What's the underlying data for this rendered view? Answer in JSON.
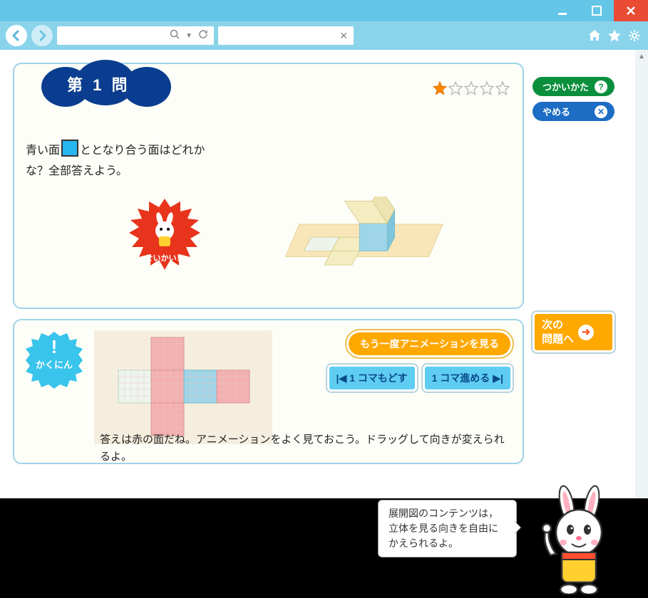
{
  "window": {
    "minimize": "minimize",
    "maximize": "maximize",
    "close": "close"
  },
  "toolbar": {
    "back": "back",
    "forward": "forward",
    "url_value": "",
    "search_value": "",
    "home": "home",
    "favorite": "favorite",
    "settings": "settings"
  },
  "util": {
    "usage_label": "つかいかた",
    "stop_label": "やめる",
    "next_label": "次の\n問題へ"
  },
  "question": {
    "badge_label": "第 1 問",
    "stars_filled": 1,
    "stars_total": 5,
    "text_before": "青い面",
    "text_after": "ととなり合う面はどれかな？全部答えよう。",
    "seikai_label": "せいかい！"
  },
  "confirm": {
    "badge_label": "かくにん",
    "replay_label": "もう一度アニメーションを見る",
    "prev_frame_label": "1 コマもどす",
    "next_frame_label": "1 コマ進める",
    "answer_text": "答えは赤の面だね。アニメーションをよく見ておこう。ドラッグして向きが変えられるよ。"
  },
  "speech": {
    "text": "展開図のコンテンツは，立体を見る向きを自由にかえられるよ。"
  },
  "colors": {
    "accent_blue": "#1d6dc4",
    "accent_green": "#0a8f3c",
    "accent_orange": "#ffa800",
    "accent_cyan": "#5fcdf2",
    "face_blue": "#27b6f0",
    "face_red": "#f08b8b",
    "face_cream": "#f4edc2"
  }
}
